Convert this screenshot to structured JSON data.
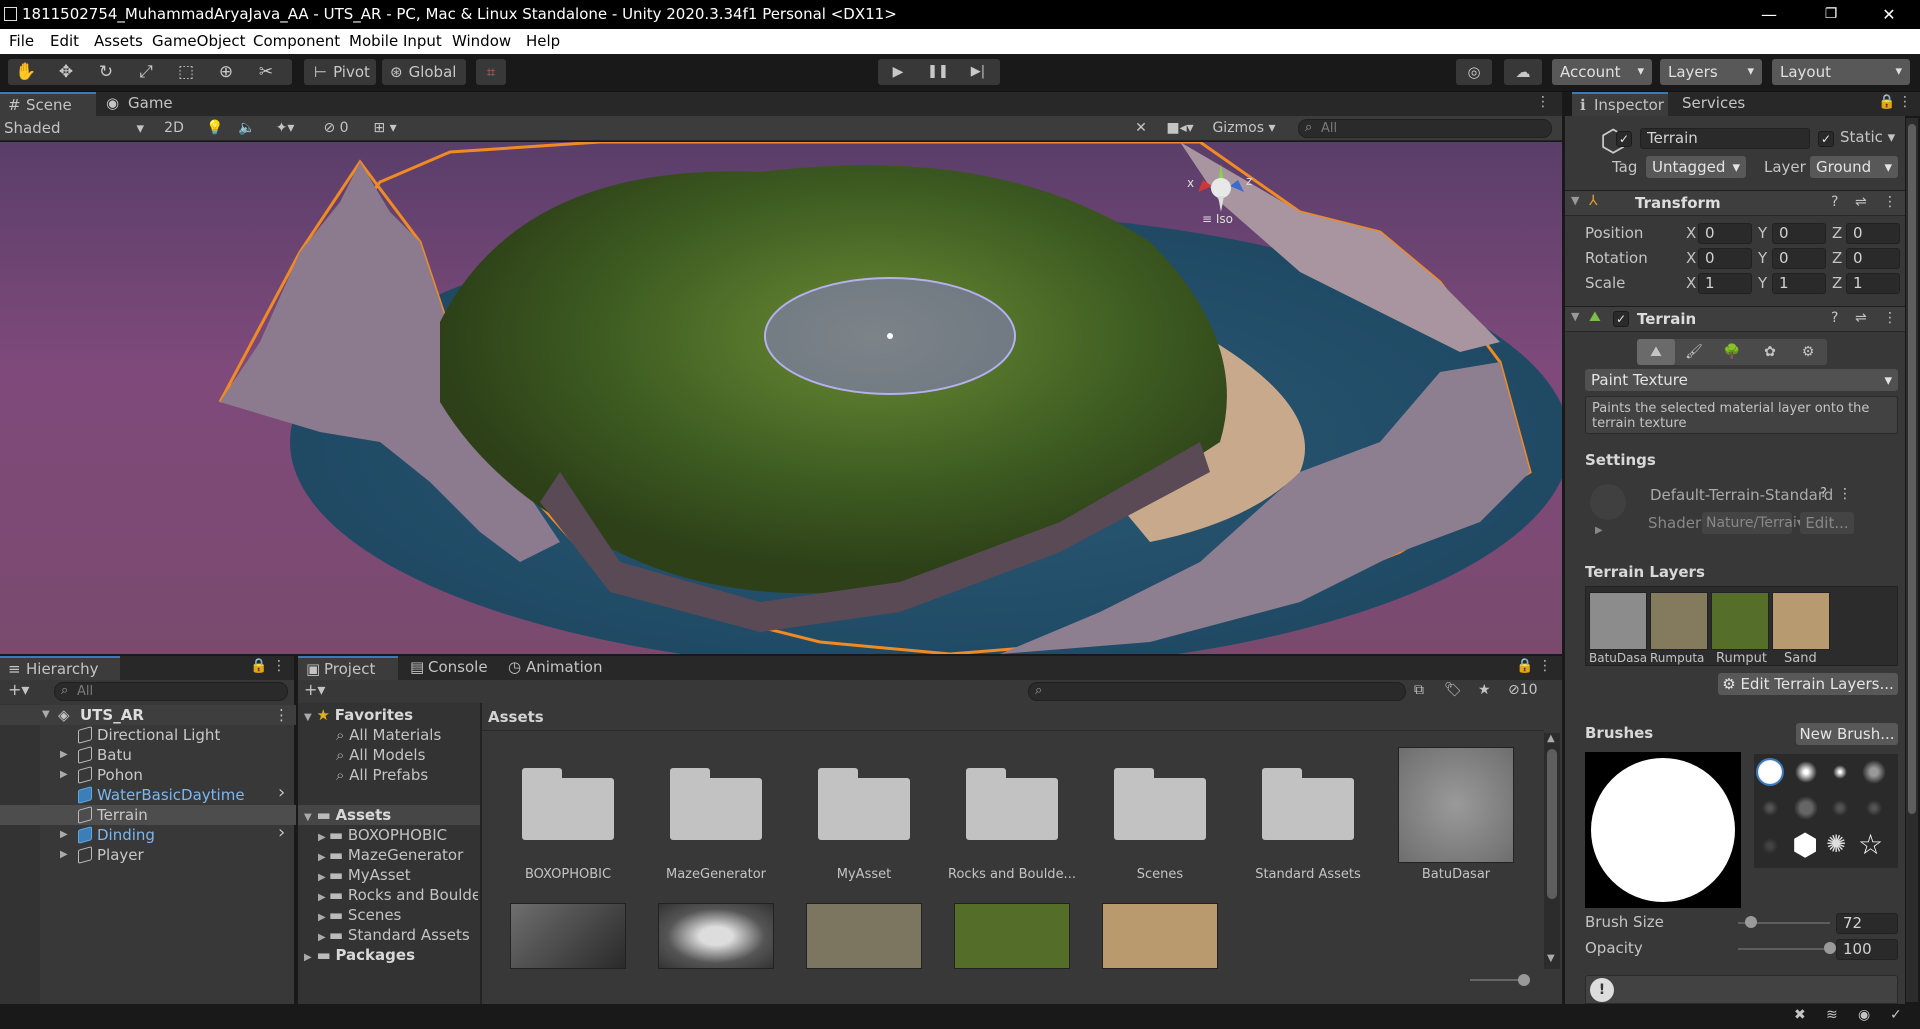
{
  "window": {
    "title": "1811502754_MuhammadAryaJava_AA - UTS_AR - PC, Mac & Linux Standalone - Unity 2020.3.34f1 Personal <DX11>",
    "minimize": "—",
    "restore": "❐",
    "close": "✕"
  },
  "menu": [
    "File",
    "Edit",
    "Assets",
    "GameObject",
    "Component",
    "Mobile Input",
    "Window",
    "Help"
  ],
  "toolbar": {
    "pivot": "Pivot",
    "global": "Global",
    "account": "Account",
    "layers": "Layers",
    "layout": "Layout"
  },
  "scene_tabs": {
    "scene": "Scene",
    "game": "Game"
  },
  "scene_bar": {
    "shading": "Shaded",
    "mode2d": "2D",
    "hidden_count": "0",
    "gizmos": "Gizmos",
    "search_placeholder": "All"
  },
  "scene_gizmo": {
    "y": "y",
    "x": "x",
    "z": "z",
    "iso": "≡ Iso"
  },
  "inspector_tabs": {
    "inspector": "Inspector",
    "services": "Services"
  },
  "inspector": {
    "object_name": "Terrain",
    "static_label": "Static",
    "tag_label": "Tag",
    "tag_value": "Untagged",
    "layer_label": "Layer",
    "layer_value": "Ground",
    "transform_title": "Transform",
    "position_label": "Position",
    "rotation_label": "Rotation",
    "scale_label": "Scale",
    "position": {
      "x": "0",
      "y": "0",
      "z": "0"
    },
    "rotation": {
      "x": "0",
      "y": "0",
      "z": "0"
    },
    "scale": {
      "x": "1",
      "y": "1",
      "z": "1"
    },
    "axis": {
      "x": "X",
      "y": "Y",
      "z": "Z"
    },
    "terrain_title": "Terrain",
    "tool_mode": "Paint Texture",
    "help_text": "Paints the selected material layer onto the terrain texture",
    "settings_label": "Settings",
    "material_name": "Default-Terrain-Standard",
    "shader_label": "Shader",
    "shader_value": "Nature/Terrai",
    "edit_button": "Edit...",
    "terrain_layers_label": "Terrain Layers",
    "layers": [
      "BatuDasar",
      "Rumputa",
      "Rumput",
      "Sand"
    ],
    "edit_layers_button": "Edit Terrain Layers...",
    "brushes_label": "Brushes",
    "new_brush_button": "New Brush...",
    "brush_size_label": "Brush Size",
    "brush_size_value": "72",
    "brush_size_fraction": 0.14,
    "opacity_label": "Opacity",
    "opacity_value": "100",
    "opacity_fraction": 1.0
  },
  "hierarchy": {
    "tab": "Hierarchy",
    "search_placeholder": "All",
    "scene": "UTS_AR",
    "items": [
      {
        "label": "Directional Light",
        "prefab": false,
        "expandable": false,
        "selected": false
      },
      {
        "label": "Batu",
        "prefab": false,
        "expandable": true,
        "selected": false
      },
      {
        "label": "Pohon",
        "prefab": false,
        "expandable": true,
        "selected": false
      },
      {
        "label": "WaterBasicDaytime",
        "prefab": true,
        "expandable": false,
        "selected": false
      },
      {
        "label": "Terrain",
        "prefab": false,
        "expandable": false,
        "selected": true
      },
      {
        "label": "Dinding",
        "prefab": true,
        "expandable": true,
        "selected": false
      },
      {
        "label": "Player",
        "prefab": false,
        "expandable": true,
        "selected": false
      }
    ]
  },
  "project": {
    "tabs": [
      "Project",
      "Console",
      "Animation"
    ],
    "hidden_count": "10",
    "favorites_label": "Favorites",
    "favorites": [
      "All Materials",
      "All Models",
      "All Prefabs"
    ],
    "assets_label": "Assets",
    "asset_folders_tree": [
      "BOXOPHOBIC",
      "MazeGenerator",
      "MyAsset",
      "Rocks and Boulde",
      "Scenes",
      "Standard Assets"
    ],
    "packages_label": "Packages",
    "breadcrumb": "Assets",
    "grid_items": [
      "BOXOPHOBIC",
      "MazeGenerator",
      "MyAsset",
      "Rocks and Boulde...",
      "Scenes",
      "Standard Assets",
      "BatuDasar"
    ]
  },
  "colors": {
    "accent": "#3a79bb",
    "selection": "#2c5d87",
    "prefab_text": "#7cb7f1",
    "selection_outline": "#f08a24",
    "panel_bg": "#383838"
  }
}
